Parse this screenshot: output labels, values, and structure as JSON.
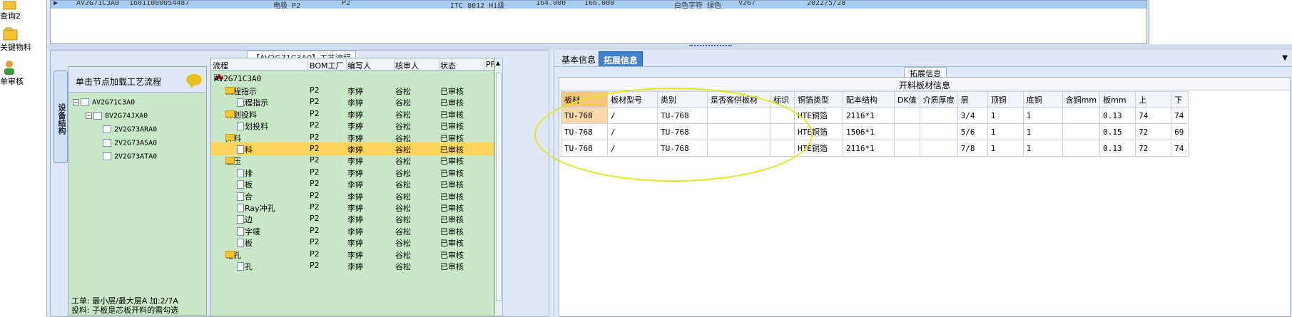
{
  "nav": {
    "items": [
      {
        "label": "查询2",
        "icon": "folder-icon"
      },
      {
        "label": "关键物料",
        "icon": "open-folder-icon"
      },
      {
        "label": "单审核",
        "icon": "user-icon"
      }
    ]
  },
  "top_grid": {
    "row": [
      "AV2G71C3A0",
      "16011080054487",
      "电极 P2",
      "P2",
      "ITC 8012 Hi级",
      "164.000",
      "166.000",
      "白色字符 绿色",
      "V267",
      "2022/5/28"
    ]
  },
  "process": {
    "title": "【AV2G71C3A0】工艺流程",
    "vertical_tab": "设备结构",
    "hint": "单击节点加载工艺流程",
    "structure_tree": [
      "AV2G71C3A0",
      "8V2G74JXA0",
      "2V2G73ARA0",
      "2V2G73ASA0",
      "2V2G73ATA0"
    ],
    "note_line1": "工单: 最小层/最大层A 加:2/7A",
    "note_line2": "投料: 子板是芯板开料的需勾选",
    "columns": [
      "流程",
      "BOM工厂",
      "编写人",
      "核审人",
      "状态",
      "PF"
    ],
    "root": "AV2G71C3A0",
    "rows": [
      {
        "name": "流程指示",
        "type": "folder",
        "bom": "P2",
        "writer": "李婷",
        "checker": "谷松",
        "status": "已审核"
      },
      {
        "name": "流程指示",
        "type": "doc",
        "bom": "P2",
        "writer": "李婷",
        "checker": "谷松",
        "status": "已审核"
      },
      {
        "name": "计划投料",
        "type": "folder",
        "bom": "P2",
        "writer": "李婷",
        "checker": "谷松",
        "status": "已审核"
      },
      {
        "name": "计划投料",
        "type": "doc",
        "bom": "P2",
        "writer": "李婷",
        "checker": "谷松",
        "status": "已审核"
      },
      {
        "name": "开料",
        "type": "folder",
        "bom": "P2",
        "writer": "李婷",
        "checker": "谷松",
        "status": "已审核"
      },
      {
        "name": "开料",
        "type": "doc",
        "bom": "P2",
        "writer": "李婷",
        "checker": "谷松",
        "status": "已审核"
      },
      {
        "name": "层压",
        "type": "folder",
        "bom": "P2",
        "writer": "李婷",
        "checker": "谷松",
        "status": "已审核"
      },
      {
        "name": "预排",
        "type": "doc",
        "bom": "P2",
        "writer": "李婷",
        "checker": "谷松",
        "status": "已审核"
      },
      {
        "name": "排板",
        "type": "doc",
        "bom": "P2",
        "writer": "李婷",
        "checker": "谷松",
        "status": "已审核"
      },
      {
        "name": "压合",
        "type": "doc",
        "bom": "P2",
        "writer": "李婷",
        "checker": "谷松",
        "status": "已审核"
      },
      {
        "name": "X-Ray冲孔",
        "type": "doc",
        "bom": "P2",
        "writer": "李婷",
        "checker": "谷松",
        "status": "已审核"
      },
      {
        "name": "铣边",
        "type": "doc",
        "bom": "P2",
        "writer": "李婷",
        "checker": "谷松",
        "status": "已审核"
      },
      {
        "name": "打字唛",
        "type": "doc",
        "bom": "P2",
        "writer": "李婷",
        "checker": "谷松",
        "status": "已审核"
      },
      {
        "name": "烘板",
        "type": "doc",
        "bom": "P2",
        "writer": "李婷",
        "checker": "谷松",
        "status": "已审核"
      },
      {
        "name": "钻孔",
        "type": "folder",
        "bom": "P2",
        "writer": "李婷",
        "checker": "谷松",
        "status": "已审核"
      },
      {
        "name": "钻孔",
        "type": "doc",
        "bom": "P2",
        "writer": "李婷",
        "checker": "谷松",
        "status": "已审核"
      }
    ]
  },
  "right": {
    "tabs": [
      "基本信息",
      "拓展信息"
    ],
    "caption": "拓展信息",
    "grid_title": "开料板材信息",
    "columns": [
      "板材",
      "板材型号",
      "类别",
      "是否客供板材",
      "标识",
      "铜箔类型",
      "配本结构",
      "DK值",
      "介质厚度",
      "层",
      "顶铜",
      "底铜",
      "含铜mm",
      "板mm",
      "上",
      "下"
    ],
    "rows": [
      [
        "TU-768",
        "/",
        "TU-768",
        "",
        "",
        "HTE铜箔",
        "2116*1",
        "",
        "",
        "3/4",
        "1",
        "1",
        "",
        "0.13",
        "74",
        "74"
      ],
      [
        "TU-768",
        "/",
        "TU-768",
        "",
        "",
        "HTE铜箔",
        "1506*1",
        "",
        "",
        "5/6",
        "1",
        "1",
        "",
        "0.15",
        "72",
        "69"
      ],
      [
        "TU-768",
        "/",
        "TU-768",
        "",
        "",
        "HTE铜箔",
        "2116*1",
        "",
        "",
        "7/8",
        "1",
        "1",
        "",
        "0.13",
        "72",
        "74"
      ]
    ]
  },
  "colors": {
    "selected_row": "#fcd35b",
    "active_tab": "#3f7fd0",
    "highlight_ellipse": "#e4e61c",
    "tree_bg": "#c8e8c8"
  }
}
